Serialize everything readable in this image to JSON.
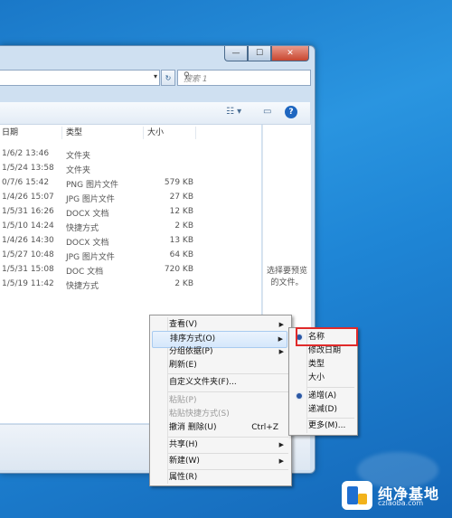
{
  "window": {
    "caption_min": "—",
    "caption_max": "☐",
    "caption_close": "✕",
    "search_placeholder": "搜索 1",
    "address_dropdown": "▾",
    "refresh_glyph": "↻",
    "search_glyph": "⚲",
    "toolbar": {
      "view_glyph": "☷ ▾",
      "pane_glyph": "▭",
      "help_glyph": "?"
    }
  },
  "columns": {
    "date": "日期",
    "type": "类型",
    "size": "大小"
  },
  "files": [
    {
      "date": "1/6/2 13:46",
      "type": "文件夹",
      "size": ""
    },
    {
      "date": "1/5/24 13:58",
      "type": "文件夹",
      "size": ""
    },
    {
      "date": "0/7/6 15:42",
      "type": "PNG 图片文件",
      "size": "579 KB"
    },
    {
      "date": "1/4/26 15:07",
      "type": "JPG 图片文件",
      "size": "27 KB"
    },
    {
      "date": "1/5/31 16:26",
      "type": "DOCX 文档",
      "size": "12 KB"
    },
    {
      "date": "1/5/10 14:24",
      "type": "快捷方式",
      "size": "2 KB"
    },
    {
      "date": "1/4/26 14:30",
      "type": "DOCX 文档",
      "size": "13 KB"
    },
    {
      "date": "1/5/27 10:48",
      "type": "JPG 图片文件",
      "size": "64 KB"
    },
    {
      "date": "1/5/31 15:08",
      "type": "DOC 文档",
      "size": "720 KB"
    },
    {
      "date": "1/5/19 11:42",
      "type": "快捷方式",
      "size": "2 KB"
    }
  ],
  "preview_text_1": "选择要预览",
  "preview_text_2": "的文件。",
  "context_menu": {
    "view": "查看(V)",
    "sort_by": "排序方式(O)",
    "group_by": "分组依据(P)",
    "refresh": "刷新(E)",
    "customize": "自定义文件夹(F)...",
    "paste": "粘贴(P)",
    "paste_shortcut": "粘贴快捷方式(S)",
    "undo_delete": "撤消 删除(U)",
    "undo_shortcut": "Ctrl+Z",
    "share": "共享(H)",
    "new": "新建(W)",
    "properties": "属性(R)"
  },
  "sort_submenu": {
    "name": "名称",
    "modified": "修改日期",
    "type": "类型",
    "size": "大小",
    "ascending": "递增(A)",
    "descending": "递减(D)",
    "more": "更多(M)..."
  },
  "watermark": {
    "title": "纯净基地",
    "url": "czlaoba.com"
  },
  "colors": {
    "highlight_border": "#e02a2a",
    "desktop": "#2a95e0"
  }
}
